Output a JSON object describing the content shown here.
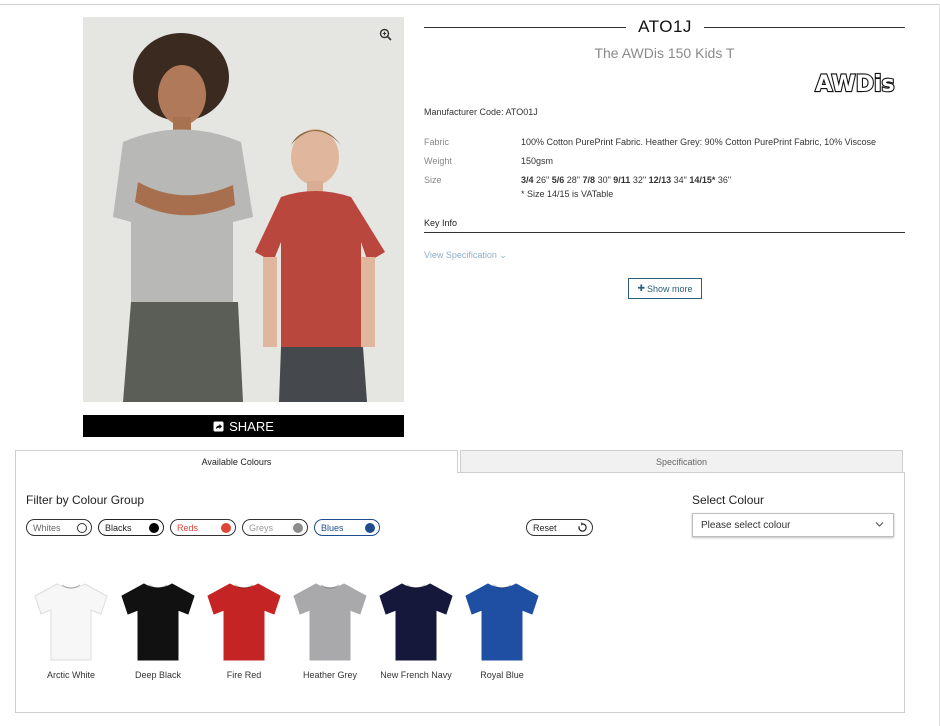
{
  "product": {
    "code": "ATO1J",
    "name": "The AWDis 150 Kids T",
    "brand_logo_text": "AWDis",
    "manufacturer_code": "Manufacturer Code: ATO01J",
    "share_label": "SHARE",
    "specs": {
      "fabric_label": "Fabric",
      "fabric_value": "100% Cotton PurePrint Fabric. Heather Grey: 90% Cotton PurePrint Fabric, 10% Viscose",
      "weight_label": "Weight",
      "weight_value": "150gsm",
      "size_label": "Size",
      "sizes": [
        {
          "size": "3/4",
          "chest": "26\""
        },
        {
          "size": "5/6",
          "chest": "28\""
        },
        {
          "size": "7/8",
          "chest": "30\""
        },
        {
          "size": "9/11",
          "chest": "32\""
        },
        {
          "size": "12/13",
          "chest": "34\""
        },
        {
          "size": "14/15*",
          "chest": "36\""
        }
      ],
      "vat_note": "* Size 14/15 is VATable"
    },
    "key_info_label": "Key Info",
    "view_spec_label": "View Specification ⌄",
    "show_more_label": "Show more",
    "show_more_icon": "✚"
  },
  "tabs": [
    {
      "label": "Available Colours",
      "active": true
    },
    {
      "label": "Specification",
      "active": false
    }
  ],
  "filter": {
    "heading": "Filter by Colour Group",
    "chips": [
      {
        "label": "Whites",
        "color": "#ffffff",
        "text_color": "#666666",
        "border": "#333333"
      },
      {
        "label": "Blacks",
        "color": "#000000",
        "text_color": "#222222",
        "border": "#222222"
      },
      {
        "label": "Reds",
        "color": "#e0453a",
        "text_color": "#e0453a",
        "border": "#333333"
      },
      {
        "label": "Greys",
        "color": "#8c8c8c",
        "text_color": "#999999",
        "border": "#333333"
      },
      {
        "label": "Blues",
        "color": "#1f4c8f",
        "text_color": "#1f4c8f",
        "border": "#1f4c8f"
      }
    ],
    "reset_label": "Reset"
  },
  "select_colour": {
    "heading": "Select Colour",
    "placeholder": "Please select colour"
  },
  "colours": [
    {
      "name": "Arctic White",
      "hex": "#f7f7f7"
    },
    {
      "name": "Deep Black",
      "hex": "#111111"
    },
    {
      "name": "Fire Red",
      "hex": "#c42424"
    },
    {
      "name": "Heather Grey",
      "hex": "#a9a9ab"
    },
    {
      "name": "New French Navy",
      "hex": "#15183a"
    },
    {
      "name": "Royal Blue",
      "hex": "#1f4fa2"
    }
  ]
}
